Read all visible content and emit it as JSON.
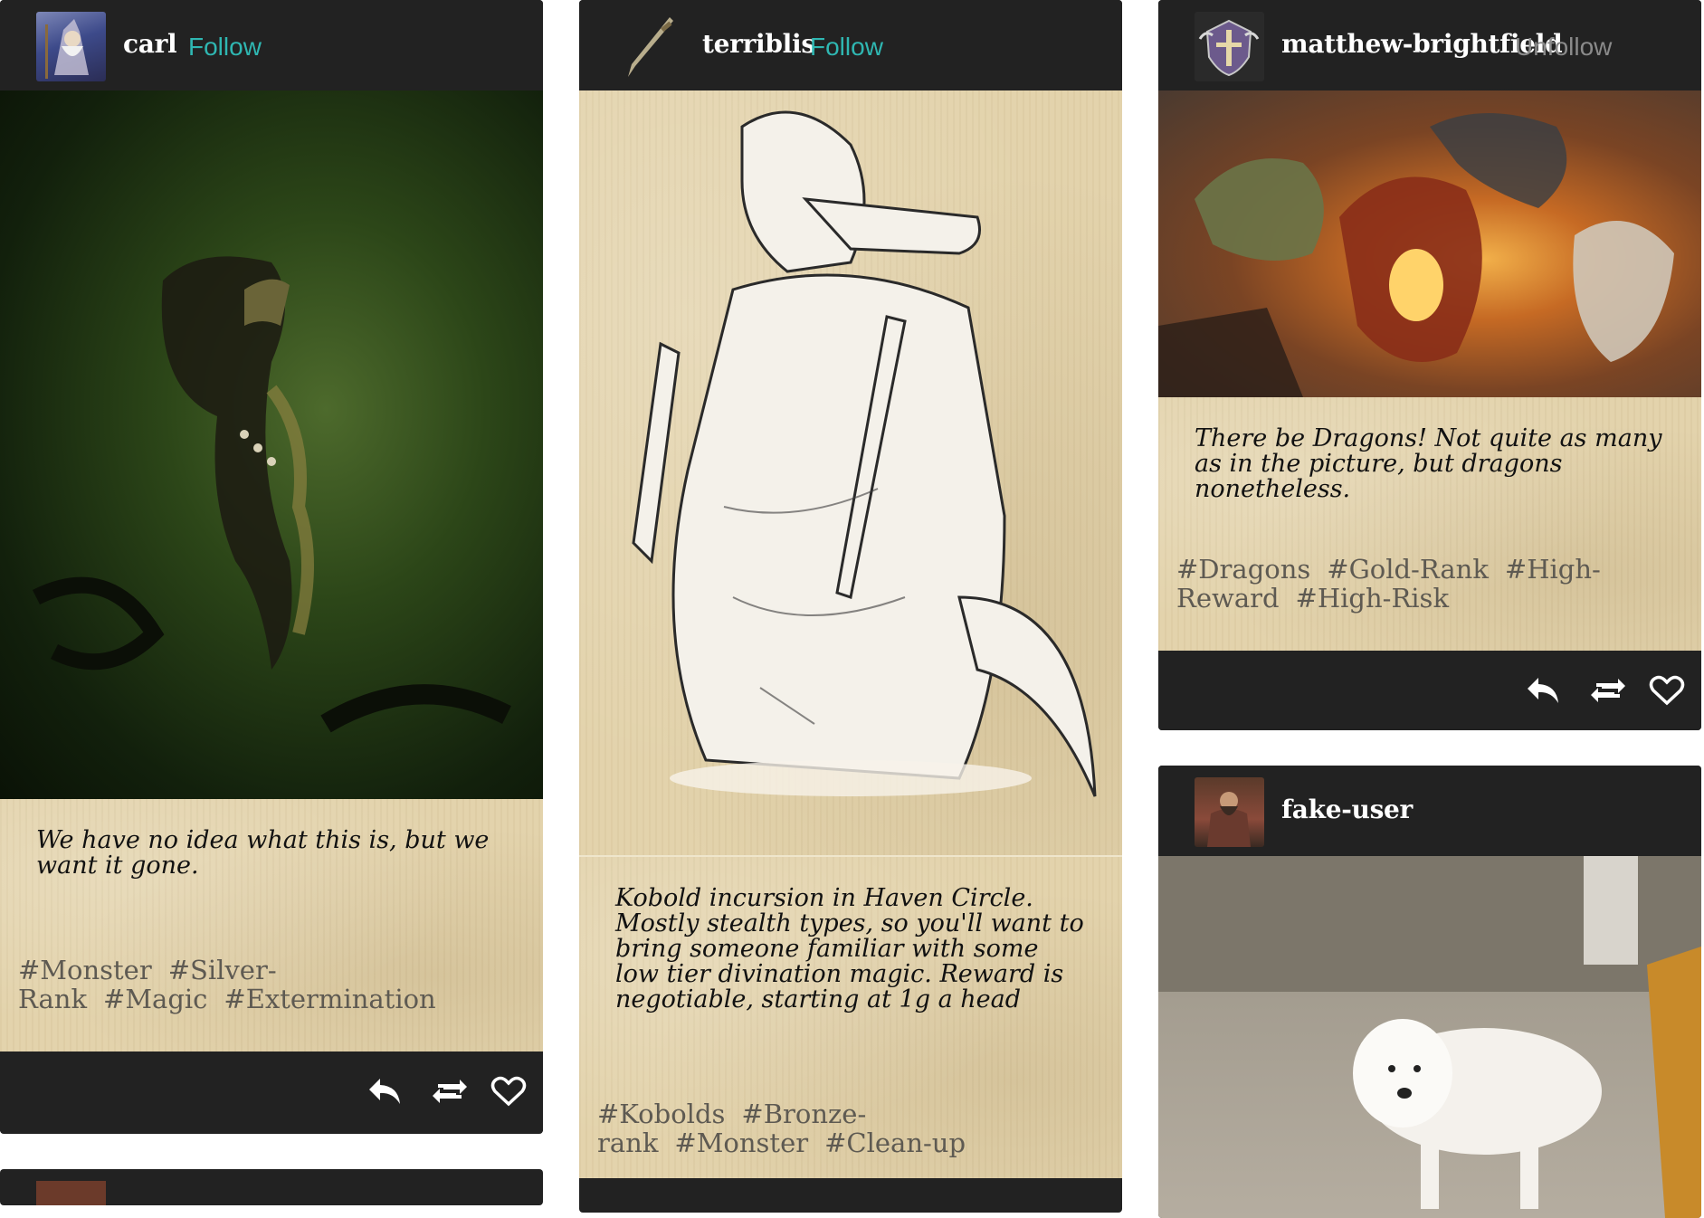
{
  "posts": {
    "carl": {
      "username": "carl",
      "follow_label": "Follow",
      "caption": "We have no idea what this is, but we want it gone.",
      "tags": [
        "#Monster",
        "#Silver-Rank",
        "#Magic",
        "#Extermination"
      ]
    },
    "terriblis": {
      "username": "terriblis",
      "follow_label": "Follow",
      "caption": "Kobold incursion in Haven Circle. Mostly stealth types, so you'll want to bring someone familiar with some low tier divination magic. Reward is negotiable, starting at 1g a head",
      "tags": [
        "#Kobolds",
        "#Bronze-rank",
        "#Monster",
        "#Clean-up"
      ]
    },
    "matthew": {
      "username": "matthew-brightfield",
      "follow_label": "Unfollow",
      "caption": "There be Dragons! Not quite as many as in the picture, but dragons nonetheless.",
      "tags": [
        "#Dragons",
        "#Gold-Rank",
        "#High-Reward",
        "#High-Risk"
      ]
    },
    "fake": {
      "username": "fake-user"
    }
  },
  "icons": {
    "reply": "reply-icon",
    "reblog": "reblog-icon",
    "like": "heart-icon"
  },
  "colors": {
    "card_bg": "#222222",
    "follow": "#2fb7b2",
    "unfollow": "#8a8a8a",
    "parchment": "#e3d3ac"
  }
}
